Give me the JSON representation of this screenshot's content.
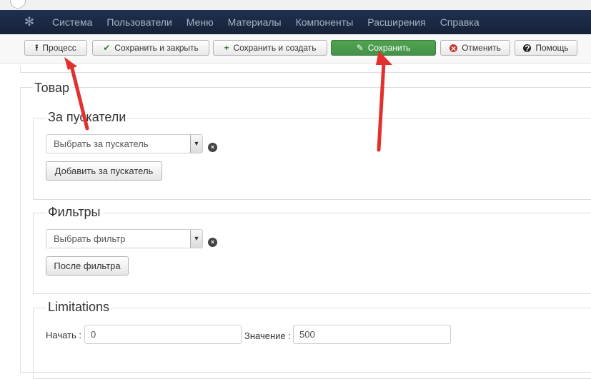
{
  "navbar": {
    "logo_icon": "joomla-logo-icon",
    "items": [
      "Система",
      "Пользователи",
      "Меню",
      "Материалы",
      "Компоненты",
      "Расширения",
      "Справка"
    ]
  },
  "toolbar": {
    "process_label": "Процесс",
    "save_close_label": "Сохранить и закрыть",
    "save_new_label": "Сохранить и создать",
    "save_label": "Сохранить",
    "cancel_label": "Отменить",
    "help_label": "Помощь"
  },
  "product": {
    "legend": "Товар",
    "launchers": {
      "legend": "За пускатели",
      "select_value": "Выбрать за пускатель",
      "add_button": "Добавить за пускатель"
    },
    "filters": {
      "legend": "Фильтры",
      "select_value": "Выбрать фильтр",
      "add_button": "После фильтра"
    },
    "limitations": {
      "legend": "Limitations",
      "start_label": "Начать :",
      "start_value": "0",
      "value_label": "Значение :",
      "value_value": "500"
    }
  },
  "colors": {
    "navbar": "#1a2a44",
    "success": "#51a351",
    "annotation_arrow": "#e2302c"
  }
}
